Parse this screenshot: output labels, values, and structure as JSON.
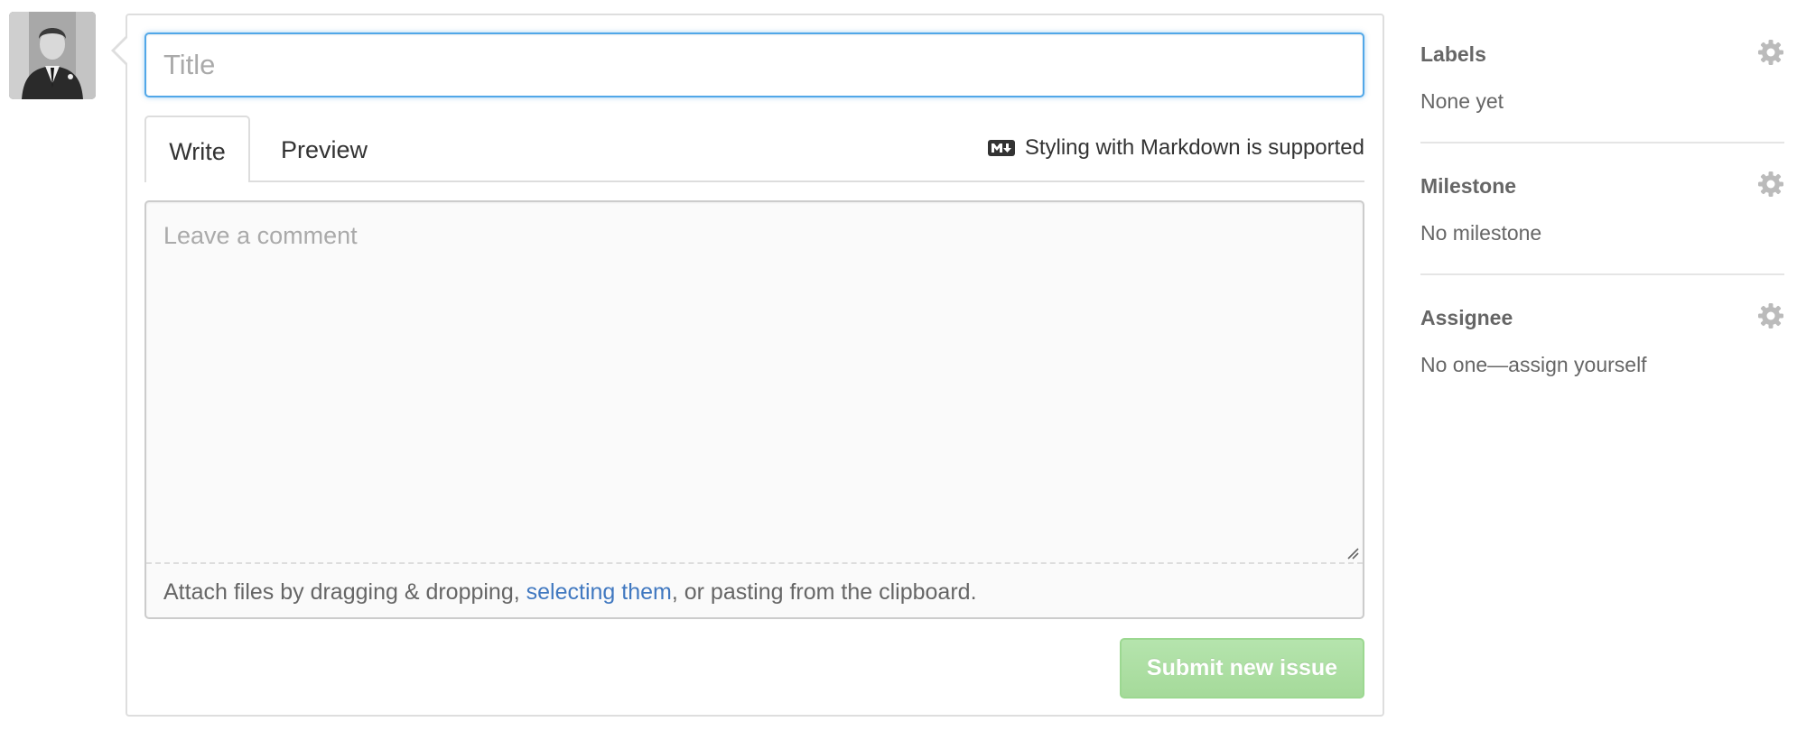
{
  "avatar": {
    "alt": "user avatar"
  },
  "issue_form": {
    "title_placeholder": "Title",
    "tabs": [
      {
        "label": "Write",
        "active": true
      },
      {
        "label": "Preview",
        "active": false
      }
    ],
    "markdown_note": "Styling with Markdown is supported",
    "comment_placeholder": "Leave a comment",
    "attach": {
      "prefix": "Attach files by dragging & dropping, ",
      "link": "selecting them",
      "suffix": ", or pasting from the clipboard."
    },
    "submit_label": "Submit new issue"
  },
  "sidebar": {
    "labels": {
      "heading": "Labels",
      "value": "None yet"
    },
    "milestone": {
      "heading": "Milestone",
      "value": "No milestone"
    },
    "assignee": {
      "heading": "Assignee",
      "value": "No one—assign yourself"
    }
  },
  "colors": {
    "focus_border": "#51a7e8",
    "link": "#4078c0",
    "submit_disabled": "#a5da9a",
    "border": "#dddddd"
  }
}
